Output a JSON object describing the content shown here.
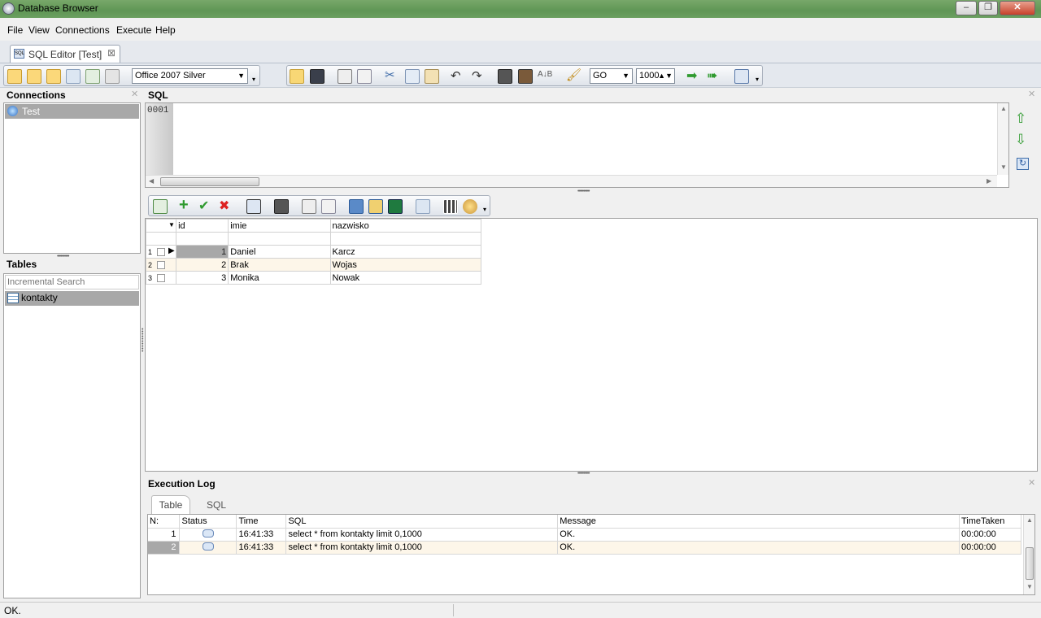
{
  "window": {
    "title": "Database Browser"
  },
  "menu": [
    "File",
    "View",
    "Connections",
    "Execute",
    "Help"
  ],
  "document_tab": {
    "label": "SQL Editor [Test]"
  },
  "toolbar": {
    "theme_select": "Office 2007 Silver",
    "delimiter_select": "GO",
    "row_limit": "1000"
  },
  "connections": {
    "title": "Connections",
    "items": [
      "Test"
    ]
  },
  "tables": {
    "title": "Tables",
    "search_placeholder": "Incremental Search",
    "items": [
      "kontakty"
    ]
  },
  "sql": {
    "title": "SQL",
    "line_number": "0001",
    "text": ""
  },
  "grid": {
    "columns": [
      "id",
      "imie",
      "nazwisko"
    ],
    "rows": [
      {
        "n": "1",
        "id": "1",
        "imie": "Daniel",
        "nazwisko": "Karcz"
      },
      {
        "n": "2",
        "id": "2",
        "imie": "Brak",
        "nazwisko": "Wojas"
      },
      {
        "n": "3",
        "id": "3",
        "imie": "Monika",
        "nazwisko": "Nowak"
      }
    ]
  },
  "execution_log": {
    "title": "Execution Log",
    "tabs": [
      "Table",
      "SQL"
    ],
    "columns": [
      "N:",
      "Status",
      "Time",
      "SQL",
      "Message",
      "TimeTaken"
    ],
    "rows": [
      {
        "n": "1",
        "time": "16:41:33",
        "sql": "select * from kontakty limit 0,1000",
        "message": "OK.",
        "taken": "00:00:00"
      },
      {
        "n": "2",
        "time": "16:41:33",
        "sql": "select * from kontakty limit 0,1000",
        "message": "OK.",
        "taken": "00:00:00"
      }
    ]
  },
  "statusbar": {
    "text": "OK."
  },
  "colors": {
    "titlebar": "#6b9f60",
    "selection": "#a8a8a8",
    "row_alt": "#fdf6e9"
  }
}
